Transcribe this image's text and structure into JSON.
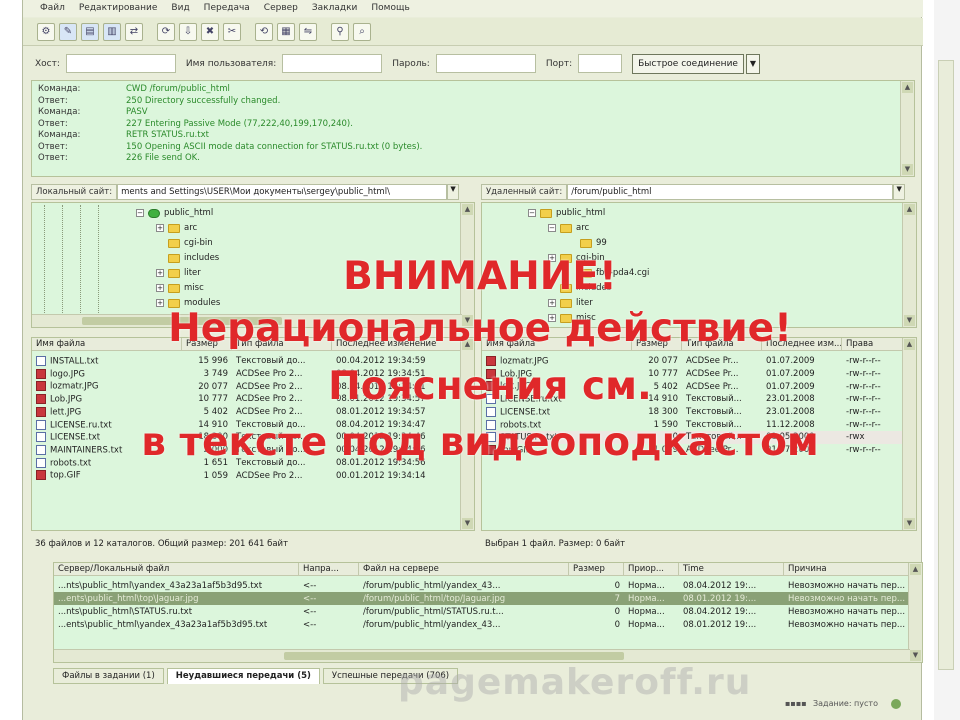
{
  "menu": [
    "Файл",
    "Редактирование",
    "Вид",
    "Передача",
    "Сервер",
    "Закладки",
    "Помощь"
  ],
  "toolbar_icons": [
    "site-manager-icon",
    "log-icon",
    "tree-local-icon",
    "tree-remote-icon",
    "queue-icon",
    "refresh-icon",
    "process-queue-icon",
    "cancel-icon",
    "disconnect-icon",
    "reconnect-icon",
    "filter-icon",
    "compare-icon",
    "sync-browse-icon",
    "search-icon"
  ],
  "quickconnect": {
    "host_label": "Хост:",
    "user_label": "Имя пользователя:",
    "pass_label": "Пароль:",
    "port_label": "Порт:",
    "button_label": "Быстрое соединение",
    "dropdown_glyph": "▼"
  },
  "log": [
    {
      "k": "Команда:",
      "v": "CWD /forum/public_html"
    },
    {
      "k": "Ответ:",
      "v": "250 Directory successfully changed."
    },
    {
      "k": "Команда:",
      "v": "PASV"
    },
    {
      "k": "Ответ:",
      "v": "227 Entering Passive Mode (77,222,40,199,170,240)."
    },
    {
      "k": "Команда:",
      "v": "RETR STATUS.ru.txt"
    },
    {
      "k": "Ответ:",
      "v": "150 Opening ASCII mode data connection for STATUS.ru.txt (0 bytes)."
    },
    {
      "k": "Ответ:",
      "v": "226 File send OK."
    }
  ],
  "local": {
    "label": "Локальный сайт:",
    "path": "ments and Settings\\USER\\Мои документы\\sergey\\public_html\\",
    "tree": [
      {
        "name": "public_html",
        "level": 0,
        "green": true,
        "exp": "−"
      },
      {
        "name": "arc",
        "level": 1,
        "exp": "+"
      },
      {
        "name": "cgi-bin",
        "level": 1,
        "exp": ""
      },
      {
        "name": "includes",
        "level": 1,
        "exp": ""
      },
      {
        "name": "liter",
        "level": 1,
        "exp": "+"
      },
      {
        "name": "misc",
        "level": 1,
        "exp": "+"
      },
      {
        "name": "modules",
        "level": 1,
        "exp": "+"
      }
    ],
    "headers": [
      "Имя файла",
      "Размер",
      "Тип файла",
      "Последнее изменение"
    ],
    "files": [
      {
        "name": "INSTALL.txt",
        "size": "15 996",
        "type": "Текстовый до...",
        "date": "00.04.2012 19:34:59",
        "img": false
      },
      {
        "name": "logo.JPG",
        "size": "3 749",
        "type": "ACDSee Pro 2...",
        "date": "08.04.2012 19:34:51",
        "img": true
      },
      {
        "name": "lozmatr.JPG",
        "size": "20 077",
        "type": "ACDSee Pro 2...",
        "date": "08.04.2012 19:34:51",
        "img": true
      },
      {
        "name": "Lob.JPG",
        "size": "10 777",
        "type": "ACDSee Pro 2...",
        "date": "08.01.2012 19:34:57",
        "img": true
      },
      {
        "name": "lett.JPG",
        "size": "5 402",
        "type": "ACDSee Pro 2...",
        "date": "08.01.2012 19:34:57",
        "img": true
      },
      {
        "name": "LICENSE.ru.txt",
        "size": "14 910",
        "type": "Текстовый до...",
        "date": "08.04.2012 19:34:47",
        "img": false
      },
      {
        "name": "LICENSE.txt",
        "size": "18 300",
        "type": "Текстовый до...",
        "date": "00.04.2012 19:34:46",
        "img": false
      },
      {
        "name": "MAINTAINERS.txt",
        "size": "2 000",
        "type": "Текстовый до...",
        "date": "00.04.2012 19:34:56",
        "img": false
      },
      {
        "name": "robots.txt",
        "size": "1 651",
        "type": "Текстовый до...",
        "date": "08.01.2012 19:34:56",
        "img": false
      },
      {
        "name": "top.GIF",
        "size": "1 059",
        "type": "ACDSee Pro 2...",
        "date": "00.01.2012 19:34:14",
        "img": true
      }
    ],
    "status": "36 файлов и 12 каталогов. Общий размер: 201 641 байт"
  },
  "remote": {
    "label": "Удаленный сайт:",
    "path": "/forum/public_html",
    "tree": [
      {
        "name": "public_html",
        "level": 0,
        "exp": "−"
      },
      {
        "name": "arc",
        "level": 1,
        "exp": "−"
      },
      {
        "name": "99",
        "level": 2,
        "exp": ""
      },
      {
        "name": "cgi-bin",
        "level": 1,
        "exp": "+"
      },
      {
        "name": "fb2-pda4.cgi",
        "level": 2,
        "exp": ""
      },
      {
        "name": "includes",
        "level": 1,
        "exp": ""
      },
      {
        "name": "liter",
        "level": 1,
        "exp": "+"
      },
      {
        "name": "misc",
        "level": 1,
        "exp": "+"
      }
    ],
    "headers": [
      "Имя файла",
      "Размер",
      "Тип файла",
      "Последнее изм...",
      "Права"
    ],
    "files": [
      {
        "name": "lozmatr.JPG",
        "size": "20 077",
        "type": "ACDSee Pr...",
        "date": "01.07.2009",
        "perm": "-rw-r--r--",
        "img": true,
        "sel": false
      },
      {
        "name": "Lob.JPG",
        "size": "10 777",
        "type": "ACDSee Pr...",
        "date": "01.07.2009",
        "perm": "-rw-r--r--",
        "img": true,
        "sel": false
      },
      {
        "name": "lett.JPG",
        "size": "5 402",
        "type": "ACDSee Pr...",
        "date": "01.07.2009",
        "perm": "-rw-r--r--",
        "img": true,
        "sel": false
      },
      {
        "name": "LICENSE.ru.txt",
        "size": "14 910",
        "type": "Текстовый...",
        "date": "23.01.2008",
        "perm": "-rw-r--r--",
        "img": false,
        "sel": false
      },
      {
        "name": "LICENSE.txt",
        "size": "18 300",
        "type": "Текстовый...",
        "date": "23.01.2008",
        "perm": "-rw-r--r--",
        "img": false,
        "sel": false
      },
      {
        "name": "robots.txt",
        "size": "1 590",
        "type": "Текстовый...",
        "date": "11.12.2008",
        "perm": "-rw-r--r--",
        "img": false,
        "sel": false
      },
      {
        "name": "STATUS.ru.txt",
        "size": "0",
        "type": "Текстовый...",
        "date": "01.05.2009",
        "perm": "-rwx",
        "img": false,
        "sel": true
      },
      {
        "name": "top.GIF",
        "size": "1 059",
        "type": "ACDSee Pr...",
        "date": "01.07.2009",
        "perm": "-rw-r--r--",
        "img": true,
        "sel": false
      }
    ],
    "status": "Выбран 1 файл. Размер: 0 байт"
  },
  "queue": {
    "headers": [
      "Сервер/Локальный файл",
      "Напра...",
      "Файл на сервере",
      "Размер",
      "Приор...",
      "Time",
      "Причина"
    ],
    "rows": [
      {
        "local": "...nts\\public_html\\yandex_43a23a1af5b3d95.txt",
        "dir": "<--",
        "remote": "/forum/public_html/yandex_43...",
        "size": "0",
        "prio": "Норма...",
        "time": "08.04.2012 19:...",
        "reason": "Невозможно начать пер...",
        "sel": false
      },
      {
        "local": "...ents\\public_html\\top\\Jaguar.jpg",
        "dir": "<--",
        "remote": "/forum/public_html/top/Jaguar.jpg",
        "size": "7",
        "prio": "Норма...",
        "time": "08.01.2012 19:...",
        "reason": "Невозможно начать пер...",
        "sel": true
      },
      {
        "local": "...nts\\public_html\\STATUS.ru.txt",
        "dir": "<--",
        "remote": "/forum/public_html/STATUS.ru.t...",
        "size": "0",
        "prio": "Норма...",
        "time": "08.04.2012 19:...",
        "reason": "Невозможно начать пер...",
        "sel": false
      },
      {
        "local": "...ents\\public_html\\yandex_43a23a1af5b3d95.txt",
        "dir": "<--",
        "remote": "/forum/public_html/yandex_43...",
        "size": "0",
        "prio": "Норма...",
        "time": "08.01.2012 19:...",
        "reason": "Невозможно начать пер...",
        "sel": false
      }
    ]
  },
  "tabs": [
    "Файлы в задании (1)",
    "Неудавшиеся передачи (5)",
    "Успешные передачи (706)"
  ],
  "statusbar": {
    "queue": "Задание: пусто"
  },
  "watermark": "pagemakeroff.ru",
  "overlay": {
    "line1": "ВНИМАНИЕ!",
    "line2": "Нерациональное действие!",
    "line3": "Пояснения см.",
    "line4": "в тексте под видеоподкастом"
  }
}
